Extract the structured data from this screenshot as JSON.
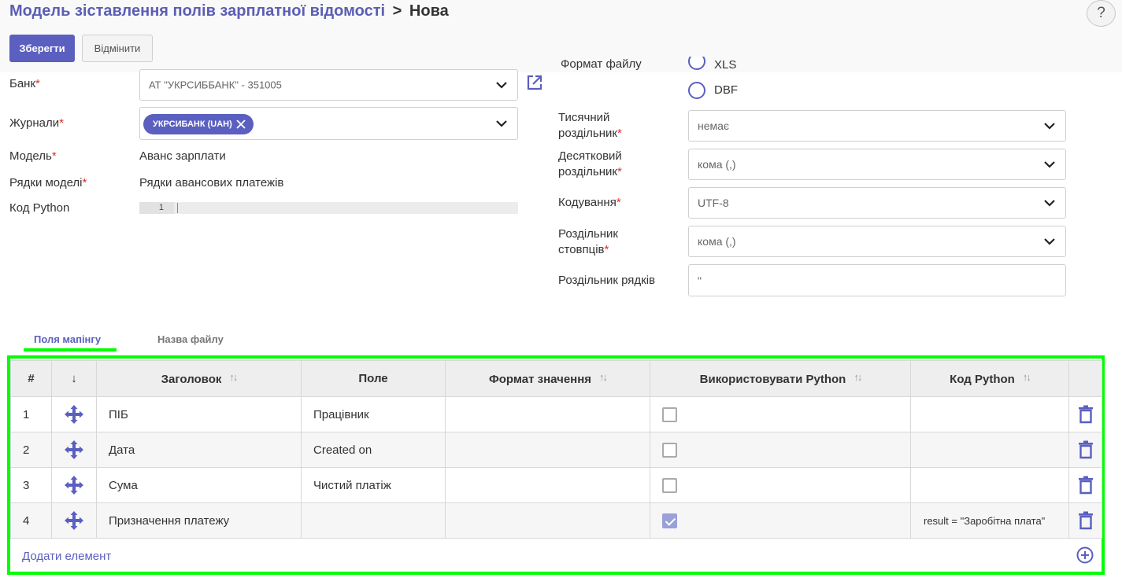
{
  "header": {
    "breadcrumb_parent": "Модель зіставлення полів зарплатної відомості",
    "breadcrumb_separator": ">",
    "breadcrumb_current": "Нова",
    "help_label": "?"
  },
  "toolbar": {
    "save_label": "Зберегти",
    "cancel_label": "Відмінити"
  },
  "form_left": {
    "bank_label": "Банк",
    "bank_value": "АТ \"УКРСИББАНК\" - 351005",
    "journals_label": "Журнали",
    "journal_tag": "УКРСИБАНК (UAH)",
    "model_label": "Модель",
    "model_value": "Аванс зарплати",
    "model_lines_label": "Рядки моделі",
    "model_lines_value": "Рядки авансових платежів",
    "python_code_label": "Код Python",
    "python_code_line": "1",
    "required_mark": "*"
  },
  "form_right": {
    "file_format_label": "Формат файлу",
    "format_option_1": "XLS",
    "format_option_2": "DBF",
    "thousands_label_1": "Тисячний",
    "thousands_label_2": "роздільник",
    "thousands_value": "немає",
    "decimal_label_1": "Десятковий",
    "decimal_label_2": "роздільник",
    "decimal_value": "кома (,)",
    "encoding_label": "Кодування",
    "encoding_value": "UTF-8",
    "column_sep_label_1": "Роздільник",
    "column_sep_label_2": "стовпців",
    "column_sep_value": "кома (,)",
    "row_sep_label": "Роздільник рядків",
    "row_sep_value": "\""
  },
  "tabs": {
    "mapping_fields": "Поля мапінгу",
    "file_name": "Назва файлу"
  },
  "table": {
    "headers": {
      "num": "#",
      "drag": "↓",
      "title": "Заголовок",
      "field": "Поле",
      "value_format": "Формат значення",
      "use_python": "Використовувати Python",
      "python_code": "Код Python"
    },
    "rows": [
      {
        "num": "1",
        "title": "ПІБ",
        "field": "Працівник",
        "value_format": "",
        "use_python": false,
        "python_code": ""
      },
      {
        "num": "2",
        "title": "Дата",
        "field": "Created on",
        "value_format": "",
        "use_python": false,
        "python_code": ""
      },
      {
        "num": "3",
        "title": "Сума",
        "field": "Чистий платіж",
        "value_format": "",
        "use_python": false,
        "python_code": ""
      },
      {
        "num": "4",
        "title": "Призначення платежу",
        "field": "",
        "value_format": "",
        "use_python": true,
        "python_code": "result = \"Заробітна плата\""
      }
    ],
    "add_item_label": "Додати елемент"
  },
  "colors": {
    "accent": "#5A5FC0",
    "highlight": "#00ff00",
    "required": "#e0302a"
  }
}
